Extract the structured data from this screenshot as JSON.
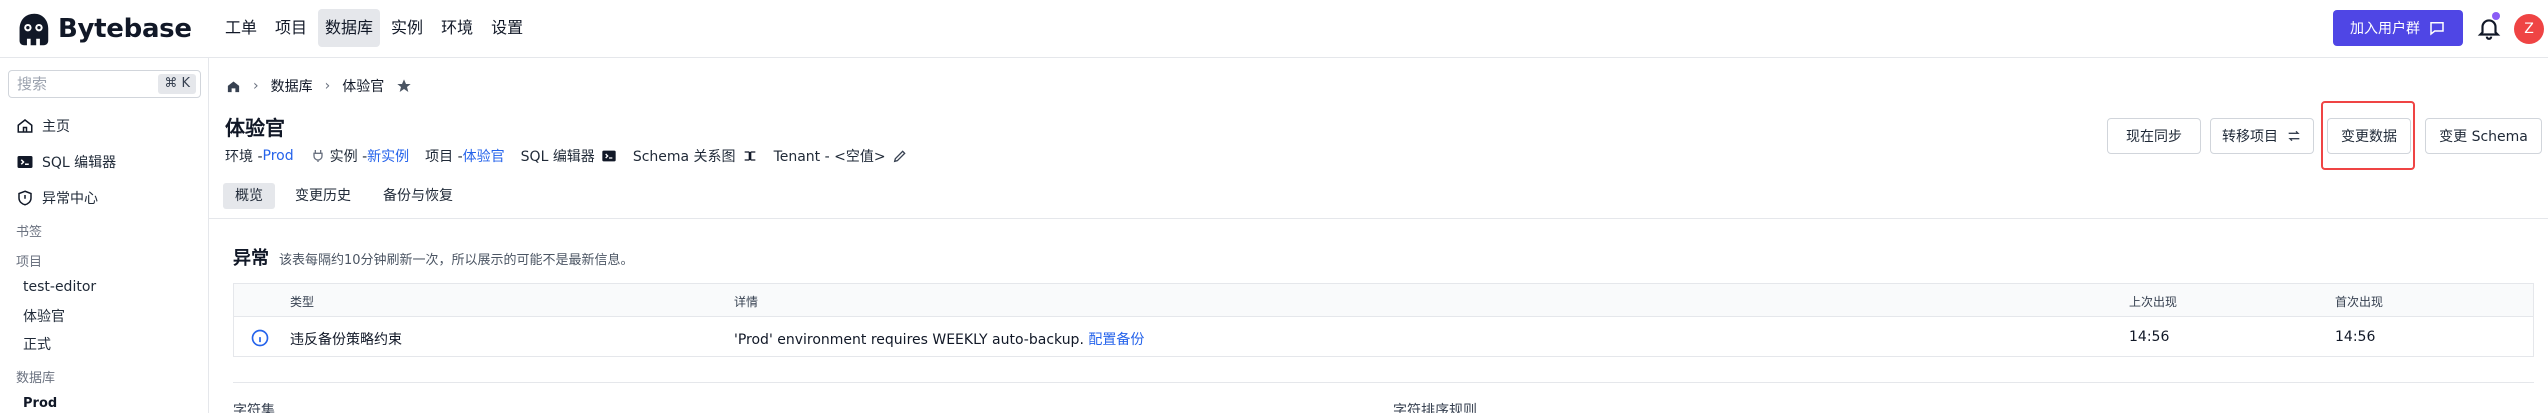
{
  "app": {
    "name": "Bytebase"
  },
  "nav": [
    "工单",
    "项目",
    "数据库",
    "实例",
    "环境",
    "设置"
  ],
  "header": {
    "join_label": "加入用户群",
    "avatar_letter": "Z"
  },
  "sidebar": {
    "search_placeholder": "搜索",
    "shortcut": "⌘ K",
    "items": [
      "主页",
      "SQL 编辑器",
      "异常中心"
    ],
    "bookmark_head": "书签",
    "project_head": "项目",
    "projects": [
      "test-editor",
      "体验官",
      "正式"
    ],
    "database_head": "数据库",
    "databases": [
      "Prod"
    ]
  },
  "breadcrumb": {
    "level1": "数据库",
    "level2": "体验官"
  },
  "page": {
    "title": "体验官",
    "env_label": "环境 - ",
    "env_value": "Prod",
    "instance_label": "实例 - ",
    "instance_value": "新实例",
    "project_label": "项目 - ",
    "project_value": "体验官",
    "sql_editor": "SQL 编辑器",
    "schema_diagram": "Schema 关系图",
    "tenant": "Tenant - <空值>"
  },
  "tabs": [
    "概览",
    "变更历史",
    "备份与恢复"
  ],
  "actions": {
    "sync": "现在同步",
    "transfer": "转移项目",
    "change_data": "变更数据",
    "change_schema": "变更 Schema"
  },
  "anomaly": {
    "title": "异常",
    "desc": "该表每隔约10分钟刷新一次，所以展示的可能不是最新信息。",
    "headers": {
      "type": "类型",
      "detail": "详情",
      "last_seen": "上次出现",
      "first_seen": "首次出现"
    },
    "row": {
      "type": "违反备份策略约束",
      "detail": "'Prod' environment requires WEEKLY auto-backup.",
      "link": "配置备份",
      "last_seen": "14:56",
      "first_seen": "14:56"
    }
  },
  "footer": {
    "charset": "字符集",
    "collation": "字符排序规则"
  },
  "colors": {
    "accent": "#4f46e5",
    "link": "#2563eb",
    "highlight": "#ef4444"
  },
  "icons": [
    "bytebase-logo-icon",
    "chat-icon",
    "bell-icon",
    "home-icon",
    "terminal-icon",
    "shield-icon",
    "star-icon",
    "plug-icon",
    "transfer-icon",
    "pencil-icon",
    "info-icon"
  ]
}
